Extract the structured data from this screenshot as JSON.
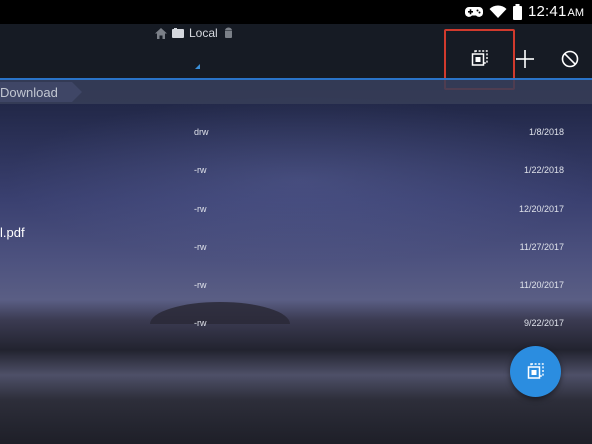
{
  "status_bar": {
    "time": "12:41",
    "ampm": "AM",
    "icons": [
      "gamepad-icon",
      "wifi-icon",
      "battery-icon"
    ]
  },
  "toolbar": {
    "location_label": "Local",
    "actions": [
      "select-mode-icon",
      "add-icon",
      "cancel-icon"
    ]
  },
  "breadcrumb": {
    "current": "Download"
  },
  "files": [
    {
      "name": "",
      "perm": "drw",
      "date": "1/8/2018"
    },
    {
      "name": "",
      "perm": "-rw",
      "date": "1/22/2018"
    },
    {
      "name": "l.pdf",
      "perm": "-rw",
      "date": "12/20/2017"
    },
    {
      "name": "",
      "perm": "-rw",
      "date": "11/27/2017"
    },
    {
      "name": "",
      "perm": "-rw",
      "date": "11/20/2017"
    },
    {
      "name": "",
      "perm": "-rw",
      "date": "9/22/2017"
    }
  ],
  "colors": {
    "accent": "#2b8de0",
    "highlight": "#d13a2d",
    "toolbar": "#161b24"
  }
}
